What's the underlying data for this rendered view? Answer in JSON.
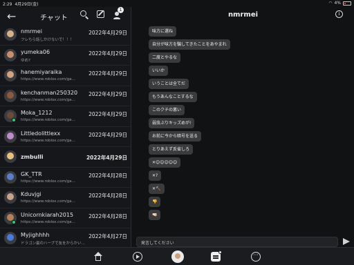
{
  "statusbar": {
    "time": "2:29",
    "date": "4月29日(金)",
    "battery": "4%"
  },
  "sidebar": {
    "title": "チャット",
    "badge_count": "1",
    "chats": [
      {
        "name": "nmrmei",
        "preview": "フレちら話しかけないで！！！",
        "date": "2022年4月29日",
        "bold": false,
        "online": false,
        "face": "#d8b08a"
      },
      {
        "name": "yumeka06",
        "preview": "ゆめ?",
        "date": "2022年4月29日",
        "bold": false,
        "online": false,
        "face": "#c98f6c"
      },
      {
        "name": "hanemiyaraika",
        "preview": "https://www.roblox.com/ga...",
        "date": "2022年4月29日",
        "bold": false,
        "online": false,
        "face": "#d6a27e"
      },
      {
        "name": "kenchanman250320",
        "preview": "https://www.roblox.com/ga...",
        "date": "2022年4月29日",
        "bold": false,
        "online": false,
        "face": "#8a5a3a"
      },
      {
        "name": "Moka_1212",
        "preview": "https://www.roblox.com/ga...",
        "date": "2022年4月29日",
        "bold": false,
        "online": true,
        "face": "#6b4a3a"
      },
      {
        "name": "Littledolittlexx",
        "preview": "https://www.roblox.com/ga...",
        "date": "2022年4月29日",
        "bold": false,
        "online": false,
        "face": "#c08ad0"
      },
      {
        "name": "zmbulli",
        "preview": "",
        "date": "2022年4月29日",
        "bold": true,
        "online": false,
        "face": "#e7c27a"
      },
      {
        "name": "GK_TTR",
        "preview": "https://www.roblox.com/ga...",
        "date": "2022年4月28日",
        "bold": false,
        "online": false,
        "face": "#5a7ec8"
      },
      {
        "name": "Kduvjgi",
        "preview": "https://www.roblox.com/ga...",
        "date": "2022年4月28日",
        "bold": false,
        "online": false,
        "face": "#c9a38a"
      },
      {
        "name": "Unicornkiarah2015",
        "preview": "https://www.roblox.com/ga...",
        "date": "2022年4月28日",
        "bold": false,
        "online": true,
        "face": "#b67e5a"
      },
      {
        "name": "Myjighhhh",
        "preview": "ドラゴン最のハーブで友をからかい...",
        "date": "2022年4月27日",
        "bold": false,
        "online": false,
        "face": "#4d7ad8"
      }
    ]
  },
  "conversation": {
    "title": "nmrmei",
    "messages": [
      "味方に選ね",
      "自分が味方を騙してきたことをあやまれ",
      "二度とやるな",
      "いいか",
      "いうことは全てだ",
      "もうあんなことするな",
      "このクチの悪い",
      "弱虫ぶりキッズめが!",
      "お前に今から暗号を送る",
      "とりあえず反省しろ",
      "✕😊😊😊😊😊",
      "✕?",
      "✕🔨",
      "👎",
      "🤜🏻"
    ],
    "input_placeholder": "発言してください"
  }
}
